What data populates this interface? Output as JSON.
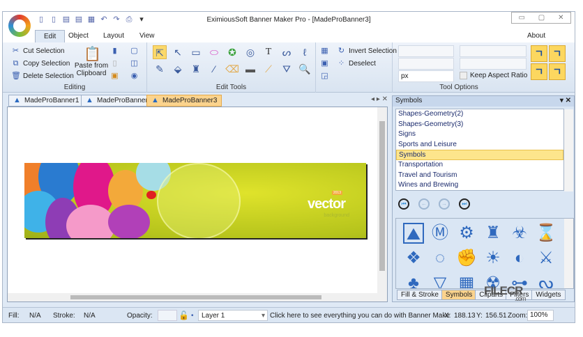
{
  "app": {
    "title": "EximiousSoft Banner Maker Pro - [MadeProBanner3]"
  },
  "window_controls": {
    "minimize": "▭",
    "maximize": "▢",
    "close": "✕"
  },
  "quick_access": [
    "new-icon",
    "open-icon",
    "copy-doc-icon",
    "save-icon",
    "save-as-icon",
    "undo-icon",
    "redo-icon",
    "print-icon",
    "customize-icon"
  ],
  "ribbon_tabs": [
    {
      "label": "Edit",
      "active": true
    },
    {
      "label": "Object"
    },
    {
      "label": "Layout"
    },
    {
      "label": "View"
    }
  ],
  "about": "About",
  "editing": {
    "cut": "Cut Selection",
    "copy": "Copy Selection",
    "delete": "Delete Selection",
    "paste": "Paste from Clipboard",
    "group": "Editing"
  },
  "edit_tools": {
    "group": "Edit Tools"
  },
  "select": {
    "invert": "Invert Selection",
    "deselect": "Deselect"
  },
  "tool_options": {
    "unit": "px",
    "keep_aspect": "Keep Aspect Ratio",
    "keep_aspect_checked": false,
    "group": "Tool Options"
  },
  "doc_tabs": [
    {
      "label": "MadeProBanner1"
    },
    {
      "label": "MadeProBanner2"
    },
    {
      "label": "MadeProBanner3",
      "active": true
    }
  ],
  "banner": {
    "text": "vector",
    "subtext": "background",
    "badge": "2013"
  },
  "panel": {
    "title": "Symbols",
    "categories": [
      "Shapes-Geometry(2)",
      "Shapes-Geometry(3)",
      "Signs",
      "Sports and Leisure",
      "Symbols",
      "Transportation",
      "Travel and Tourism",
      "Wines and Brewing"
    ],
    "selected": "Symbols",
    "tabs": [
      "Fill & Stroke",
      "Symbols",
      "Cliparts",
      "Filters",
      "Widgets"
    ],
    "active_tab": "Symbols"
  },
  "status": {
    "fill_label": "Fill:",
    "fill": "N/A",
    "stroke_label": "Stroke:",
    "stroke": "N/A",
    "opacity_label": "Opacity:",
    "layer": "Layer 1",
    "hint": "Click here to see everything you can do with Banner Make",
    "x_label": "X:",
    "x": "188.13",
    "y_label": "Y:",
    "y": "156.51",
    "zoom_label": "Zoom:",
    "zoom": "100%"
  },
  "watermark": {
    "text": "FILECR",
    "sub": ".com"
  }
}
